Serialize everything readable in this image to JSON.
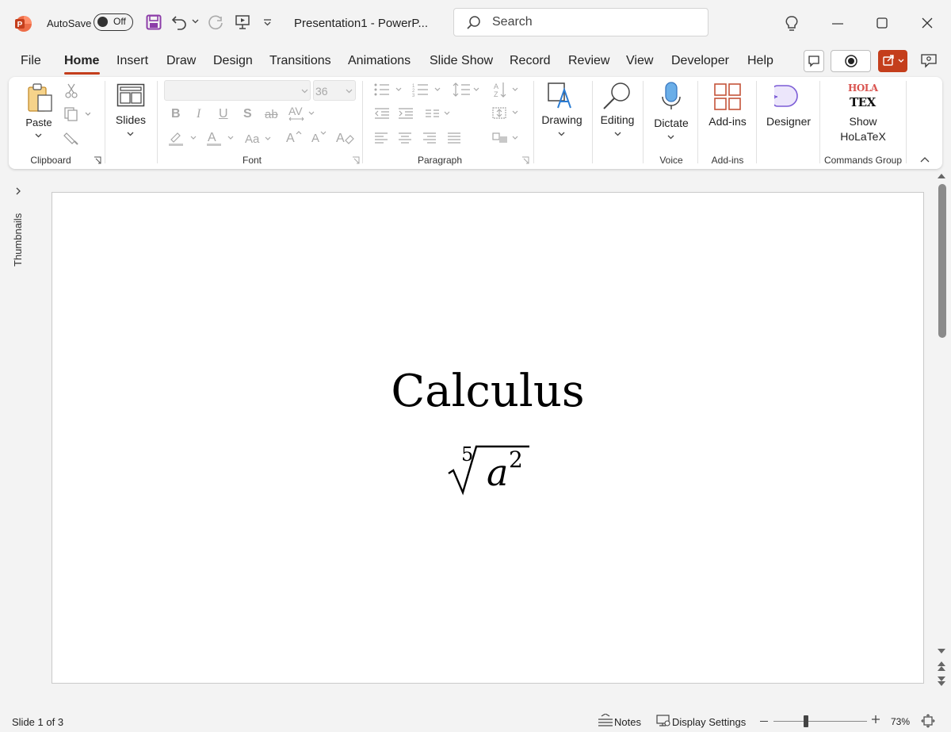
{
  "titlebar": {
    "autosave_label": "AutoSave",
    "autosave_state": "Off",
    "doc_title": "Presentation1  -  PowerP...",
    "search_placeholder": "Search"
  },
  "tabs": [
    "File",
    "Home",
    "Insert",
    "Draw",
    "Design",
    "Transitions",
    "Animations",
    "Slide Show",
    "Record",
    "Review",
    "View",
    "Developer",
    "Help"
  ],
  "active_tab": "Home",
  "ribbon": {
    "paste": "Paste",
    "clipboard": "Clipboard",
    "slides": "Slides",
    "font_size": "36",
    "font_group": "Font",
    "paragraph_group": "Paragraph",
    "drawing": "Drawing",
    "editing": "Editing",
    "dictate": "Dictate",
    "voice_group": "Voice",
    "addins": "Add-ins",
    "addins_group": "Add-ins",
    "designer": "Designer",
    "show_line1": "Show",
    "show_line2": "HoLaTeX",
    "commands_group": "Commands Group",
    "holatex_logo_top": "HOLA",
    "holatex_logo_bottom": "TEX"
  },
  "side_panel": {
    "thumbnails": "Thumbnails"
  },
  "slide": {
    "title": "Calculus",
    "formula_index": "5",
    "formula_base": "a",
    "formula_exp": "2"
  },
  "statusbar": {
    "slide_info": "Slide 1 of 3",
    "notes": "Notes",
    "display_settings": "Display Settings",
    "zoom": "73%"
  },
  "colors": {
    "accent": "#c43e1c",
    "share_button": "#c43e1c",
    "save_icon": "#8c3da8",
    "mic": "#4a90d9",
    "addins_icon": "#c4543a",
    "designer_icon": "#7b5cd6"
  }
}
